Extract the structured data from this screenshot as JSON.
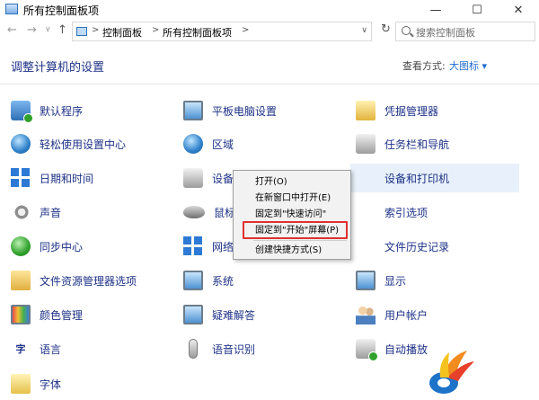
{
  "window": {
    "title": "所有控制面板项",
    "minimize_glyph": "—",
    "maximize_glyph": "☐",
    "close_glyph": "✕"
  },
  "nav": {
    "back_glyph": "←",
    "forward_glyph": "→",
    "dropdown_glyph": "∨",
    "up_glyph": "↑",
    "refresh_glyph": "↻"
  },
  "address": {
    "segments": [
      "控制面板",
      "所有控制面板项"
    ],
    "separator": ">",
    "dropdown_glyph": "∨"
  },
  "search": {
    "placeholder": "搜索控制面板"
  },
  "header": {
    "title": "调整计算机的设置",
    "view_by_label": "查看方式:",
    "view_by_value": "大图标 ▾"
  },
  "items": [
    {
      "label": "默认程序",
      "icon": "default-programs-icon"
    },
    {
      "label": "平板电脑设置",
      "icon": "tablet-settings-icon"
    },
    {
      "label": "凭据管理器",
      "icon": "credential-manager-icon"
    },
    {
      "label": "轻松使用设置中心",
      "icon": "ease-of-access-icon"
    },
    {
      "label": "区域",
      "icon": "region-globe-icon"
    },
    {
      "label": "任务栏和导航",
      "icon": "taskbar-icon"
    },
    {
      "label": "日期和时间",
      "icon": "date-time-icon"
    },
    {
      "label": "设备",
      "icon": "device-manager-icon"
    },
    {
      "label": "设备和打印机",
      "icon": "devices-printers-icon"
    },
    {
      "label": "声音",
      "icon": "sound-icon"
    },
    {
      "label": "鼠标",
      "icon": "mouse-icon"
    },
    {
      "label": "索引选项",
      "icon": "indexing-options-icon"
    },
    {
      "label": "同步中心",
      "icon": "sync-center-icon"
    },
    {
      "label": "网络",
      "icon": "network-icon"
    },
    {
      "label": "文件历史记录",
      "icon": "file-history-icon"
    },
    {
      "label": "文件资源管理器选项",
      "icon": "file-explorer-options-icon"
    },
    {
      "label": "系统",
      "icon": "system-icon"
    },
    {
      "label": "显示",
      "icon": "display-icon"
    },
    {
      "label": "颜色管理",
      "icon": "color-management-icon"
    },
    {
      "label": "疑难解答",
      "icon": "troubleshooting-icon"
    },
    {
      "label": "用户帐户",
      "icon": "user-accounts-icon"
    },
    {
      "label": "语言",
      "icon": "language-icon"
    },
    {
      "label": "语音识别",
      "icon": "speech-recognition-icon"
    },
    {
      "label": "自动播放",
      "icon": "autoplay-icon"
    },
    {
      "label": "字体",
      "icon": "fonts-icon"
    }
  ],
  "context_menu": {
    "items": [
      "打开(O)",
      "在新窗口中打开(E)",
      "固定到\"快速访问\"",
      "固定到\"开始\"屏幕(P)",
      "创建快捷方式(S)"
    ],
    "highlighted_index": 3
  },
  "icon_glyphs": {
    "language": "字"
  },
  "colors": {
    "link_blue": "#1e3287",
    "accent_blue": "#1e6ccf",
    "highlight_red": "#e03030",
    "menu_bg": "#f2f2f2"
  }
}
